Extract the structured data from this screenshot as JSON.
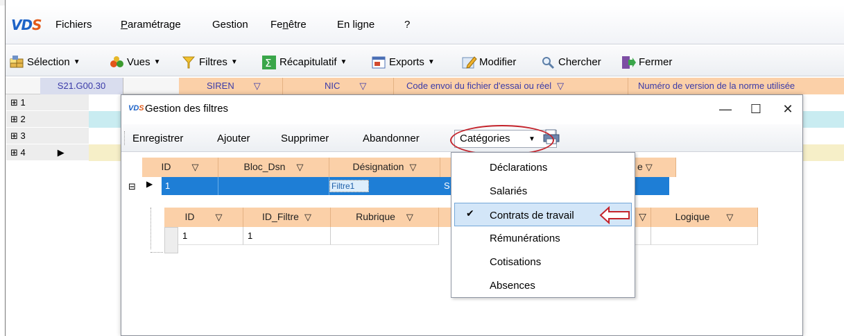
{
  "app": {
    "logo": {
      "v": "V",
      "d": "D",
      "s": "S"
    },
    "menu": [
      {
        "label": "Fichiers"
      },
      {
        "label_pre": "",
        "label_u": "P",
        "label_post": "aramétrage"
      },
      {
        "label": "Gestion"
      },
      {
        "label_pre": "Fe",
        "label_u": "n",
        "label_post": "être"
      },
      {
        "label": "En ligne"
      },
      {
        "label": "?"
      }
    ],
    "toolbar": {
      "selection": "Sélection",
      "vues": "Vues",
      "filtres": "Filtres",
      "recap": "Récapitulatif",
      "exports": "Exports",
      "modifier": "Modifier",
      "chercher": "Chercher",
      "fermer": "Fermer"
    },
    "grid": {
      "left_header": "S21.G00.30",
      "headers": [
        "SIREN",
        "NIC",
        "Code envoi du fichier d'essai ou réel",
        "Numéro de version de la norme utilisée"
      ],
      "rows": [
        "1",
        "2",
        "3",
        "4"
      ]
    }
  },
  "dialog": {
    "title": "Gestion des filtres",
    "toolbar": {
      "enregistrer": "Enregistrer",
      "ajouter": "Ajouter",
      "supprimer": "Supprimer",
      "abandonner": "Abandonner",
      "categories": "Catégories"
    },
    "main_grid": {
      "headers": [
        "ID",
        "Bloc_Dsn",
        "Désignation",
        "",
        "e"
      ],
      "row": {
        "id": "1",
        "bloc": "",
        "designation": "Filtre1",
        "next": "S"
      }
    },
    "sub_grid": {
      "headers": [
        "ID",
        "ID_Filtre",
        "Rubrique",
        "",
        "Logique"
      ],
      "row": {
        "id": "1",
        "id_filtre": "1"
      }
    }
  },
  "dropdown": {
    "items": [
      "Déclarations",
      "Salariés",
      "Contrats de travail",
      "Rémunérations",
      "Cotisations",
      "Absences"
    ],
    "checked_index": 2
  },
  "colors": {
    "accent": "#1e7ed6",
    "header_orange": "#fbd0a8",
    "annotation_red": "#c4232b"
  }
}
